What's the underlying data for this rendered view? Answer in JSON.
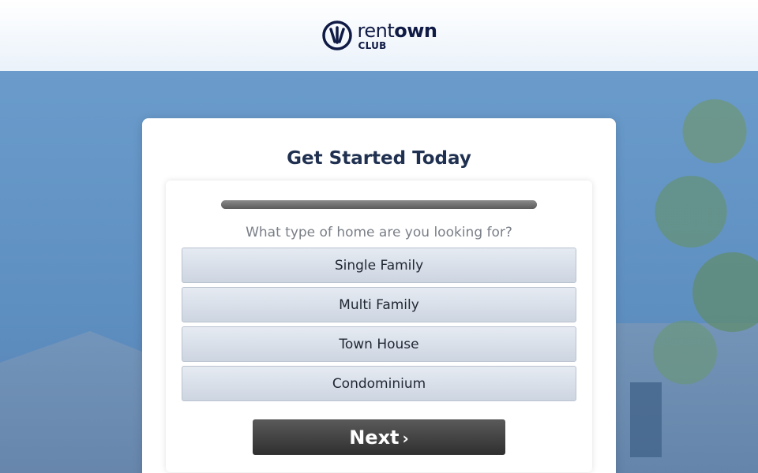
{
  "brand": {
    "word_thin": "rent",
    "word_bold": "own",
    "sub": "CLUB",
    "color": "#0f1a45"
  },
  "form": {
    "title": "Get Started Today",
    "progress": 1.0,
    "question": "What type of home are you looking for?",
    "options": [
      "Single Family",
      "Multi Family",
      "Town House",
      "Condominium"
    ],
    "next_label": "Next",
    "next_icon": "chevron-right-icon"
  },
  "colors": {
    "title": "#1f3050",
    "button_dark": "#2f2f2f",
    "option_bg": "#dbe1ea"
  }
}
